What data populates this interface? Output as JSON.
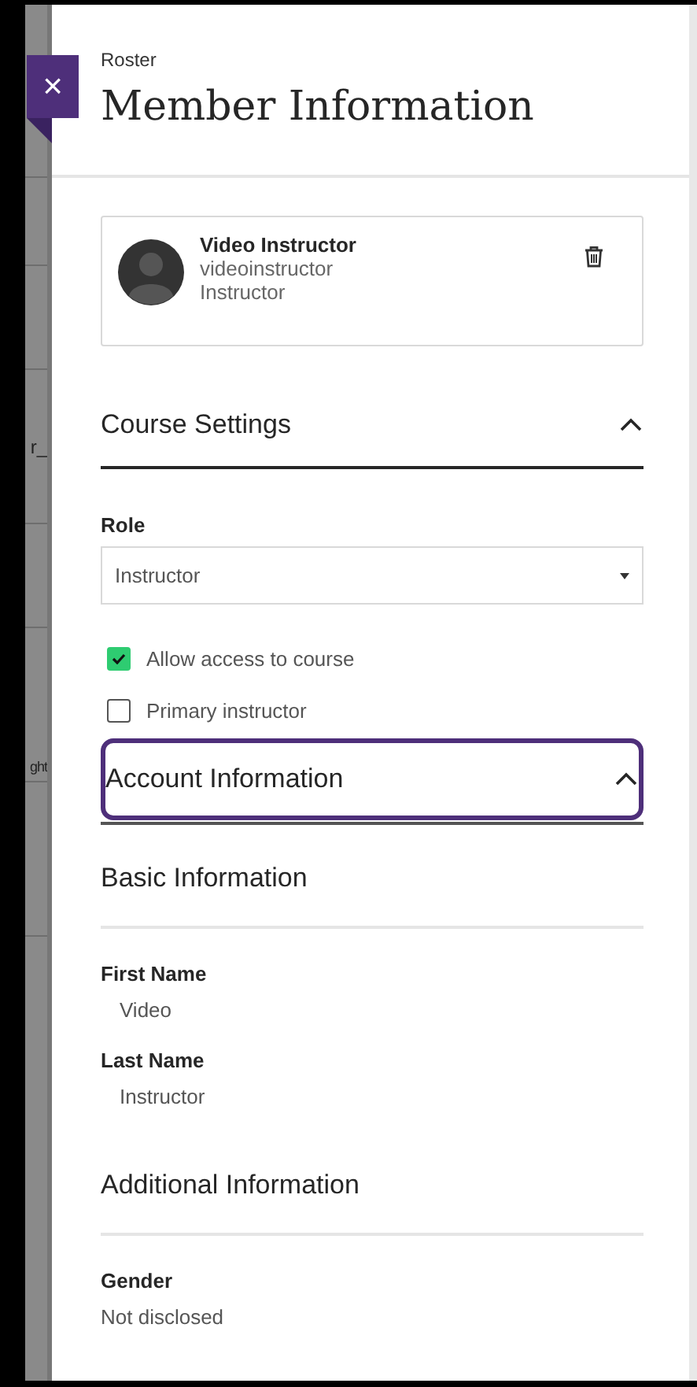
{
  "background": {
    "cells": [
      "r_",
      "ght"
    ]
  },
  "close_button": {
    "label": "×"
  },
  "breadcrumb": "Roster",
  "title": "Member Information",
  "member": {
    "name": "Video Instructor",
    "username": "videoinstructor",
    "role": "Instructor"
  },
  "course_settings": {
    "title": "Course Settings",
    "expanded": true,
    "role": {
      "label": "Role",
      "value": "Instructor"
    },
    "checkboxes": [
      {
        "label": "Allow access to course",
        "checked": true
      },
      {
        "label": "Primary instructor",
        "checked": false
      }
    ]
  },
  "account_information": {
    "title": "Account Information",
    "expanded": true,
    "focused": true,
    "subsections": [
      {
        "title": "Basic Information",
        "fields": [
          {
            "label": "First Name",
            "value": "Video",
            "indented": true
          },
          {
            "label": "Last Name",
            "value": "Instructor",
            "indented": true
          }
        ]
      },
      {
        "title": "Additional Information",
        "fields": [
          {
            "label": "Gender",
            "value": "Not disclosed",
            "indented": false
          }
        ]
      }
    ]
  }
}
